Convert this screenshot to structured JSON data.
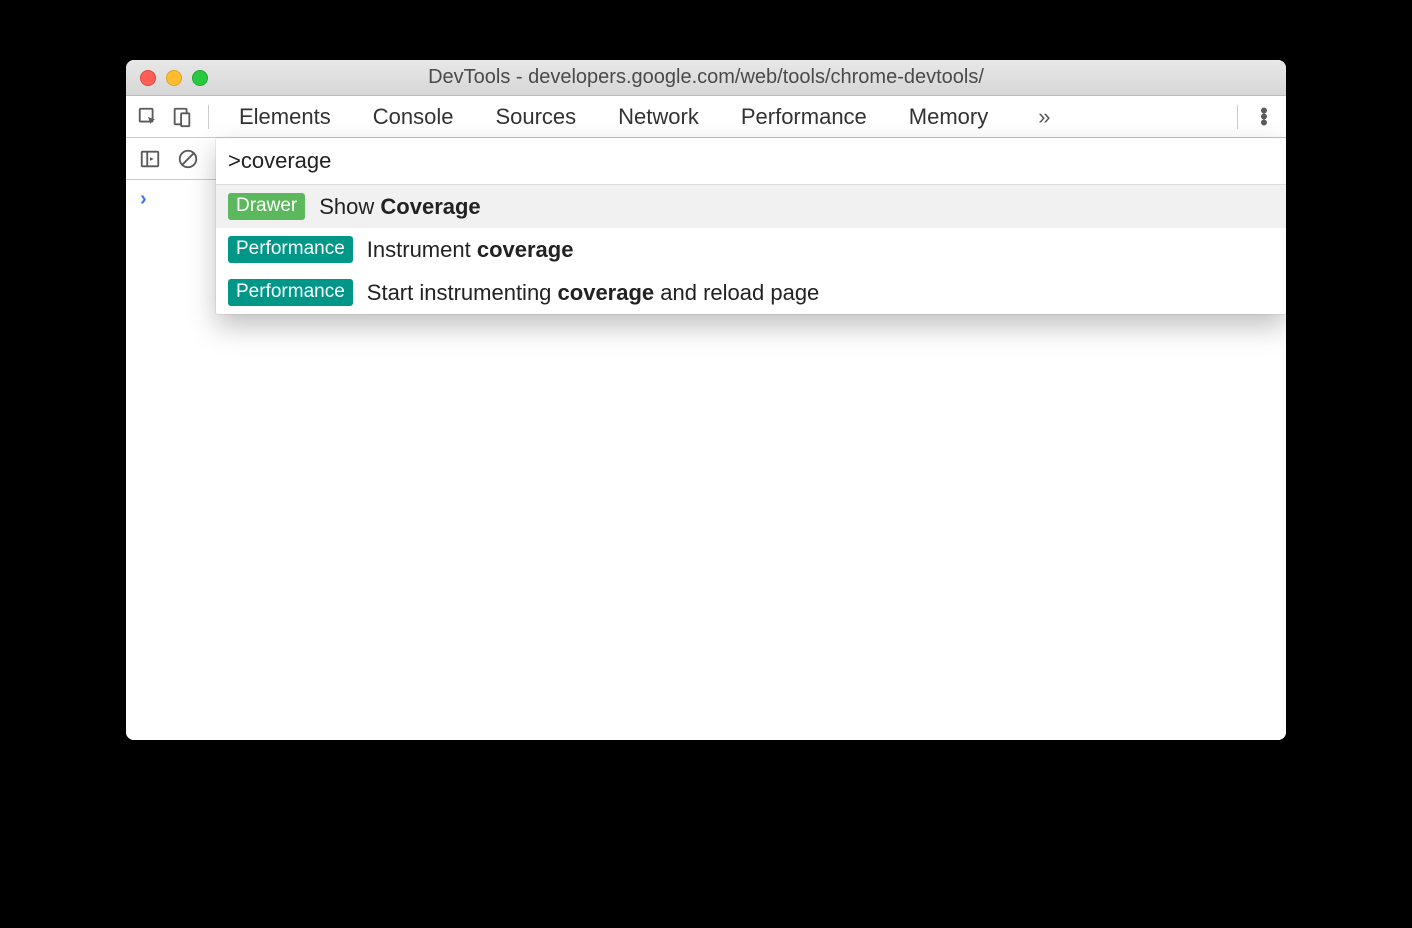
{
  "window": {
    "title": "DevTools - developers.google.com/web/tools/chrome-devtools/"
  },
  "tabs": {
    "items": [
      "Elements",
      "Console",
      "Sources",
      "Network",
      "Performance",
      "Memory"
    ],
    "active": "Console",
    "overflow_glyph": "»"
  },
  "command": {
    "input": ">coverage",
    "results": [
      {
        "badge": "Drawer",
        "badge_kind": "drawer",
        "text_pre": "Show ",
        "text_bold": "Coverage",
        "text_post": "",
        "selected": true
      },
      {
        "badge": "Performance",
        "badge_kind": "perf",
        "text_pre": "Instrument ",
        "text_bold": "coverage",
        "text_post": "",
        "selected": false
      },
      {
        "badge": "Performance",
        "badge_kind": "perf",
        "text_pre": "Start instrumenting ",
        "text_bold": "coverage",
        "text_post": " and reload page",
        "selected": false
      }
    ]
  },
  "console": {
    "prompt": "›"
  }
}
